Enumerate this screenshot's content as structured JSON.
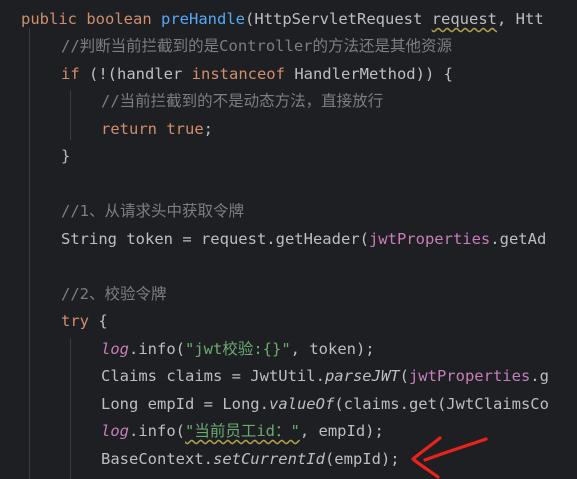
{
  "code": {
    "line1": {
      "public": "public",
      "boolean": "boolean",
      "method": "preHandle",
      "paren_open": "(",
      "param_type": "HttpServletRequest",
      "param_name": "request",
      "rest": ", Htt"
    },
    "line2": {
      "comment": "//判断当前拦截到的是Controller的方法还是其他资源"
    },
    "line3": {
      "kw_if": "if",
      "part1": " (!(handler ",
      "kw_instanceof": "instanceof",
      "part2": " HandlerMethod)) {"
    },
    "line4": {
      "comment": "//当前拦截到的不是动态方法，直接放行"
    },
    "line5": {
      "kw_return": "return",
      "kw_true": "true",
      "semi": ";"
    },
    "line6": {
      "brace": "}"
    },
    "line7": {
      "comment": "//1、从请求头中获取令牌"
    },
    "line8": {
      "part1": "String token = request.getHeader(",
      "field": "jwtProperties",
      "part2": ".getAd"
    },
    "line9": {
      "comment": "//2、校验令牌"
    },
    "line10": {
      "kw_try": "try",
      "brace": " {"
    },
    "line11": {
      "log": "log",
      "call": ".info(",
      "string": "\"jwt校验:{}\"",
      "rest": ", token);"
    },
    "line12": {
      "part1": "Claims claims = JwtUtil.",
      "method": "parseJWT",
      "paren": "(",
      "field": "jwtProperties",
      "rest": ".g"
    },
    "line13": {
      "part1": "Long empId = Long.",
      "method": "valueOf",
      "rest": "(claims.get(JwtClaimsCo"
    },
    "line14": {
      "log": "log",
      "call": ".info(",
      "string": "\"当前员工id：\"",
      "rest": ", empId);"
    },
    "line15": {
      "part1": "BaseContext.",
      "method": "setCurrentId",
      "rest": "(empId);"
    }
  },
  "colors": {
    "background": "#1e1f22",
    "text": "#bcbec4",
    "keyword": "#cf8e6d",
    "method_declaration": "#56a8f5",
    "comment": "#7a7e85",
    "field": "#c77dbb",
    "string": "#6aab73",
    "annotation_stroke": "#e8231b"
  },
  "annotation": {
    "type": "hand-drawn red arrow pointing at setCurrentId line"
  }
}
